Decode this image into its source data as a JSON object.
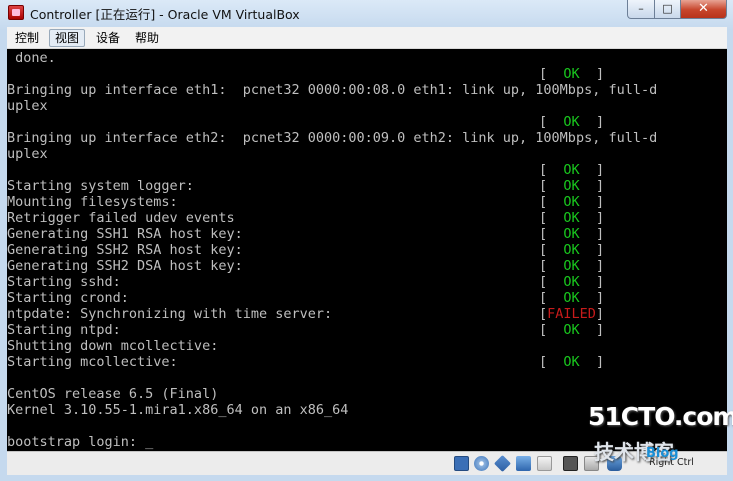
{
  "window": {
    "title": "Controller [正在运行] - Oracle VM VirtualBox",
    "minimize_glyph": "–",
    "maximize_glyph": "□",
    "close_glyph": "✕"
  },
  "menu": {
    "items": [
      {
        "label": "控制"
      },
      {
        "label": "视图"
      },
      {
        "label": "设备"
      },
      {
        "label": "帮助"
      }
    ]
  },
  "console": {
    "lines": [
      " done.",
      "Bringing up interface eth1:  pcnet32 0000:00:08.0 eth1: link up, 100Mbps, full-d",
      "uplex",
      "Bringing up interface eth2:  pcnet32 0000:00:09.0 eth2: link up, 100Mbps, full-d",
      "uplex",
      "Starting system logger:",
      "Mounting filesystems:",
      "Retrigger failed udev events",
      "Generating SSH1 RSA host key:",
      "Generating SSH2 RSA host key:",
      "Generating SSH2 DSA host key:",
      "Starting sshd:",
      "Starting crond:",
      "ntpdate: Synchronizing with time server:",
      "Starting ntpd:",
      "Shutting down mcollective:",
      "Starting mcollective:",
      "CentOS release 6.5 (Final)",
      "Kernel 3.10.55-1.mira1.x86_64 on an x86_64",
      "bootstrap login: _"
    ],
    "status_ok": "OK",
    "status_failed": "FAILED",
    "bracket_open": "[",
    "bracket_close": "]"
  },
  "statusbar": {
    "host_key_label": "Right Ctrl",
    "icons": [
      "hard-disk-icon",
      "optical-drive-icon",
      "usb-icon",
      "network-icon",
      "shared-folder-icon",
      "display-icon",
      "capture-icon",
      "mouse-integration-icon"
    ]
  },
  "watermark": {
    "brand": "51CTO.com",
    "tagline": "技术博客",
    "blog": "Blog"
  },
  "colors": {
    "ok": "#19c81e",
    "failed": "#c71b1b",
    "console_text": "#bfbfbf",
    "console_bg": "#000000"
  }
}
